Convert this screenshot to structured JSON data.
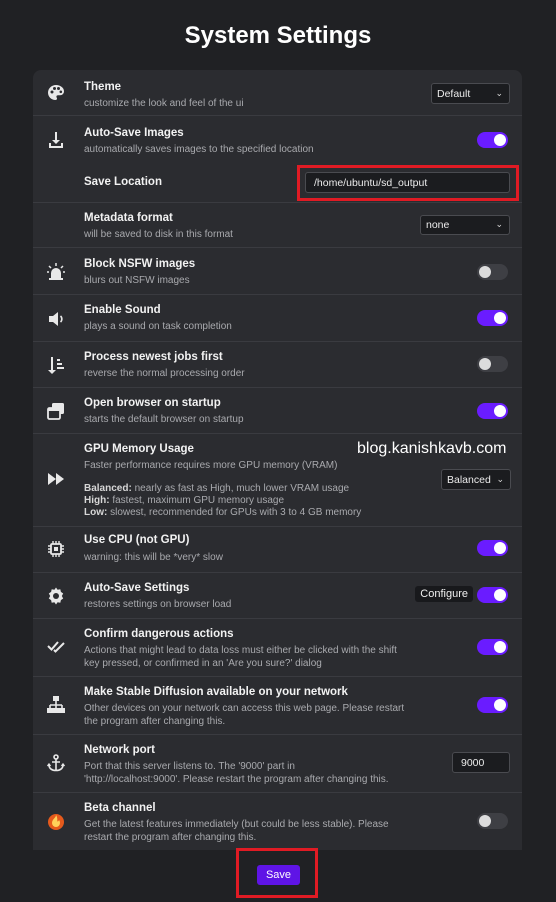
{
  "page": {
    "title": "System Settings",
    "watermark": "blog.kanishkavb.com"
  },
  "settings": {
    "theme": {
      "label": "Theme",
      "desc": "customize the look and feel of the ui",
      "value": "Default"
    },
    "autosave_images": {
      "label": "Auto-Save Images",
      "desc": "automatically saves images to the specified location",
      "enabled": true
    },
    "save_location": {
      "label": "Save Location",
      "value": "/home/ubuntu/sd_output"
    },
    "metadata_format": {
      "label": "Metadata format",
      "desc": "will be saved to disk in this format",
      "value": "none"
    },
    "block_nsfw": {
      "label": "Block NSFW images",
      "desc": "blurs out NSFW images",
      "enabled": false
    },
    "enable_sound": {
      "label": "Enable Sound",
      "desc": "plays a sound on task completion",
      "enabled": true
    },
    "process_newest": {
      "label": "Process newest jobs first",
      "desc": "reverse the normal processing order",
      "enabled": false
    },
    "open_browser": {
      "label": "Open browser on startup",
      "desc": "starts the default browser on startup",
      "enabled": true
    },
    "gpu_memory": {
      "label": "GPU Memory Usage",
      "desc": "Faster performance requires more GPU memory (VRAM)",
      "balanced_label": "Balanced:",
      "balanced_desc": " nearly as fast as High, much lower VRAM usage",
      "high_label": "High:",
      "high_desc": " fastest, maximum GPU memory usage",
      "low_label": "Low:",
      "low_desc": " slowest, recommended for GPUs with 3 to 4 GB memory",
      "value": "Balanced"
    },
    "use_cpu": {
      "label": "Use CPU (not GPU)",
      "desc": "warning: this will be *very* slow",
      "enabled": true
    },
    "autosave_settings": {
      "label": "Auto-Save Settings",
      "desc": "restores settings on browser load",
      "configure_label": "Configure",
      "enabled": true
    },
    "confirm_dangerous": {
      "label": "Confirm dangerous actions",
      "desc1": "Actions that might lead to data loss must either be clicked with the shift",
      "desc2": "key pressed, or confirmed in an 'Are you sure?' dialog",
      "enabled": true
    },
    "network": {
      "label": "Make Stable Diffusion available on your network",
      "desc1": "Other devices on your network can access this web page. Please restart",
      "desc2": "the program after changing this.",
      "enabled": true
    },
    "network_port": {
      "label": "Network port",
      "desc1": "Port that this server listens to. The '9000' part in",
      "desc2": "'http://localhost:9000'. Please restart the program after changing this.",
      "value": "9000"
    },
    "beta_channel": {
      "label": "Beta channel",
      "desc1": "Get the latest features immediately (but could be less stable). Please",
      "desc2": "restart the program after changing this.",
      "enabled": false
    }
  },
  "footer": {
    "save_label": "Save"
  },
  "colors": {
    "accent": "#6a1cff",
    "highlight": "#e01b24",
    "background": "#202124",
    "panel": "#2b2c30"
  }
}
